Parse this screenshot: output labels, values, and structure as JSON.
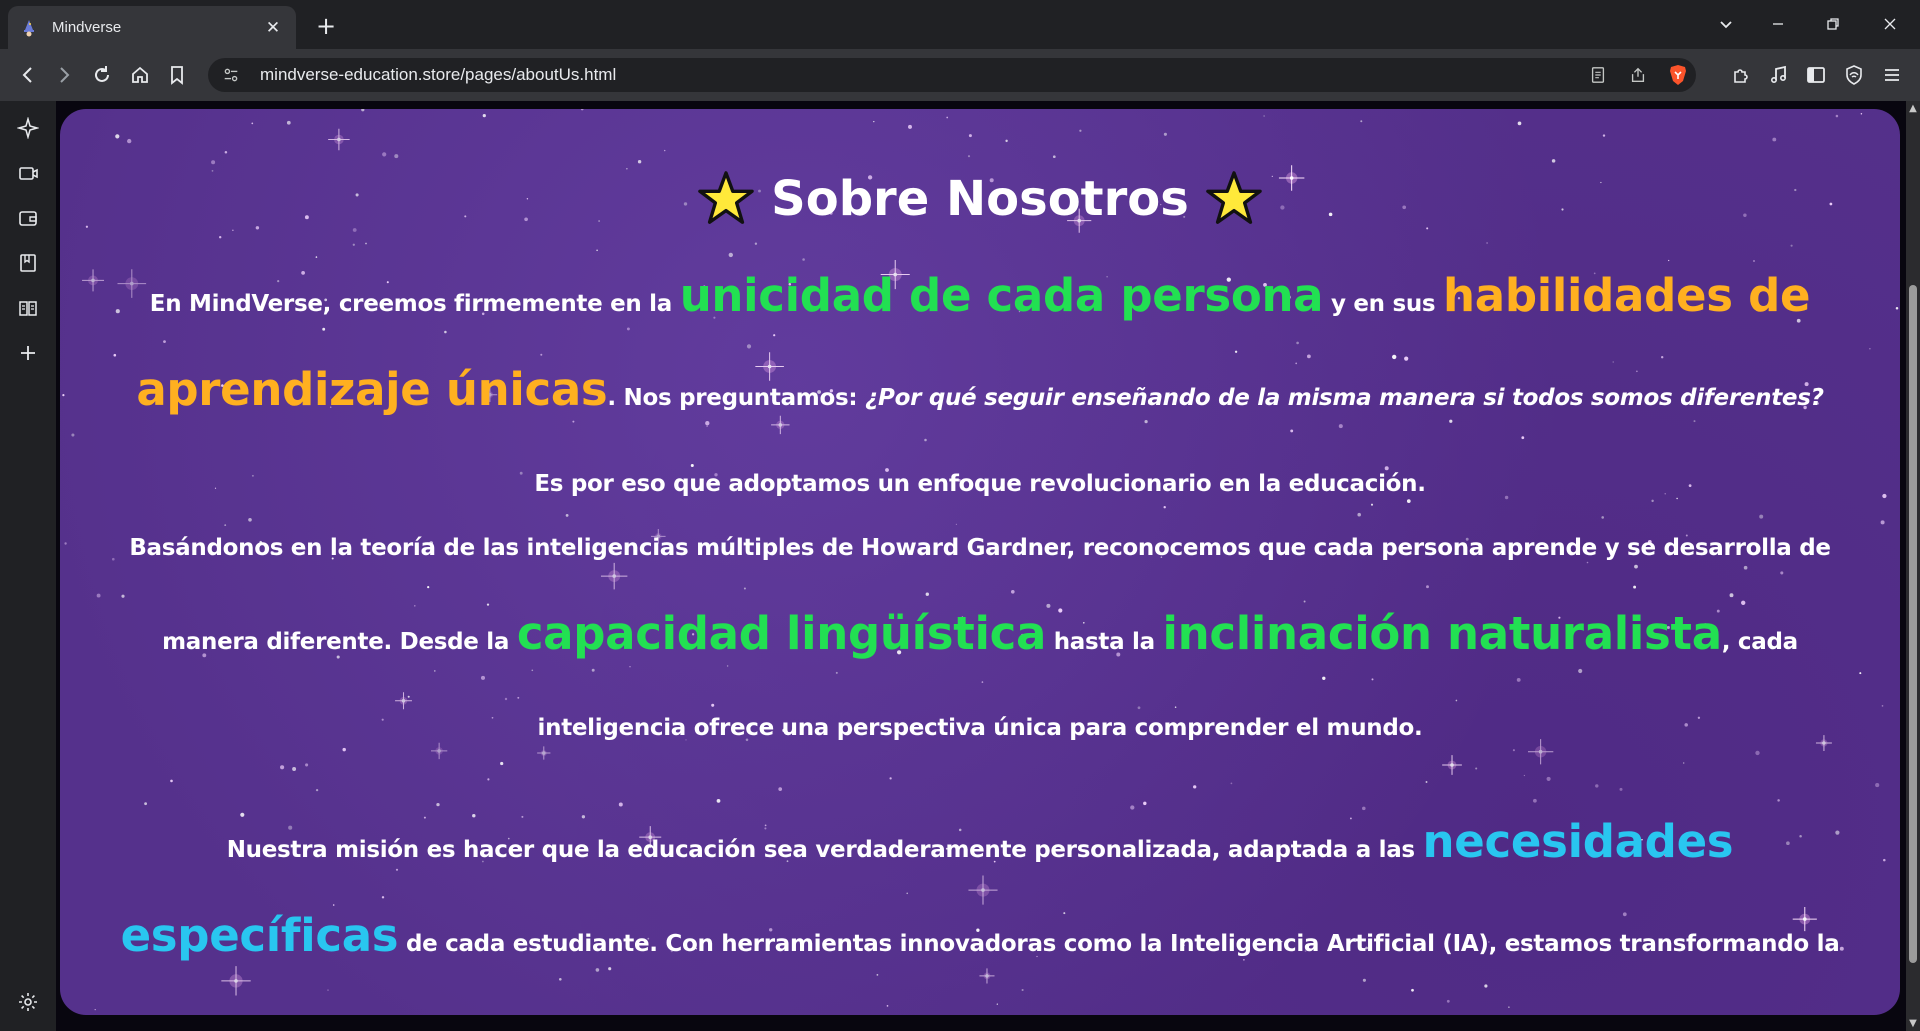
{
  "browser": {
    "tab": {
      "title": "Mindverse",
      "favicon": "wizard-icon"
    },
    "url": "mindverse-education.store/pages/aboutUs.html",
    "accent_brave": "#fb542b"
  },
  "page": {
    "heading": "Sobre Nosotros",
    "p1": {
      "a": "En ",
      "b": "MindVerse",
      "c": ", creemos firmemente en la ",
      "h1": "unicidad de cada persona",
      "d": " y en sus ",
      "h2": "habilidades de aprendizaje únicas",
      "e": ". Nos preguntamos: ",
      "q": "¿Por qué seguir enseñando de la misma manera si todos somos diferentes?",
      "f": " Es por eso que adoptamos un enfoque ",
      "g": "revolucionario",
      "h": " en la educación."
    },
    "p2": {
      "a": "Basándonos en la teoría de ",
      "b": "las inteligencias múltiples",
      "c": " de Howard Gardner, reconocemos que cada persona aprende y se desarrolla de manera diferente. Desde la ",
      "h1": "capacidad lingüística",
      "d": " hasta la ",
      "h2": "inclinación naturalista",
      "e": ", cada inteligencia ofrece una perspectiva única para comprender el mundo."
    },
    "p3": {
      "a": "Nuestra misión es hacer que la educación sea verdaderamente ",
      "b": "personalizada",
      "c": ", adaptada a las ",
      "h1": "necesidades específicas",
      "d": " de cada estudiante. Con herramientas innovadoras como la ",
      "e": "Inteligencia Artificial (IA)",
      "f": ", estamos transformando la forma en que se enseña y se aprende."
    },
    "colors": {
      "background": "#55318c",
      "green": "#22e052",
      "orange": "#ffb020",
      "cyan": "#29c6f0"
    }
  }
}
